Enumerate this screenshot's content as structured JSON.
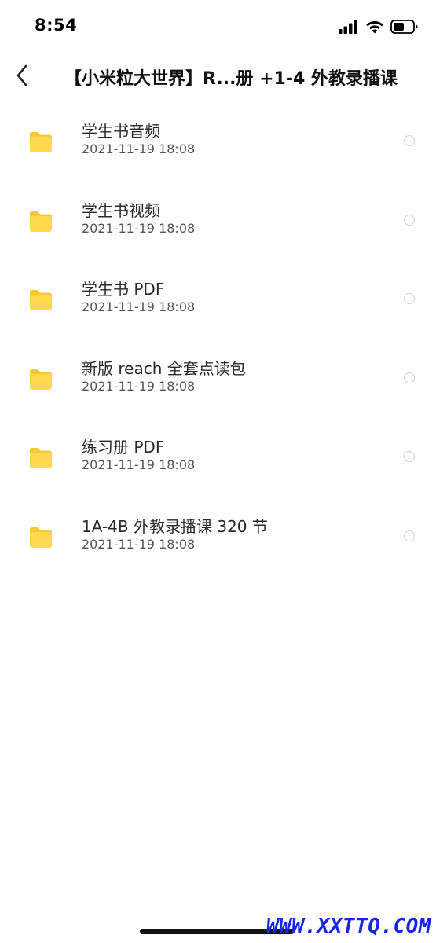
{
  "status_bar": {
    "time": "8:54",
    "icons": [
      "signal-icon",
      "wifi-icon",
      "battery-icon"
    ]
  },
  "header": {
    "back_icon": "chevron-left-icon",
    "title": "【小米粒大世界】R...册 +1-4 外教录播课"
  },
  "files": [
    {
      "name": "学生书音频",
      "date": "2021-11-19 18:08",
      "icon": "folder-icon"
    },
    {
      "name": "学生书视频",
      "date": "2021-11-19 18:08",
      "icon": "folder-icon"
    },
    {
      "name": "学生书 PDF",
      "date": "2021-11-19 18:08",
      "icon": "folder-icon"
    },
    {
      "name": "新版 reach 全套点读包",
      "date": "2021-11-19 18:08",
      "icon": "folder-icon"
    },
    {
      "name": "练习册 PDF",
      "date": "2021-11-19 18:08",
      "icon": "folder-icon"
    },
    {
      "name": "1A-4B 外教录播课 320 节",
      "date": "2021-11-19 18:08",
      "icon": "folder-icon"
    }
  ],
  "watermark": "WWW.XXTTQ.COM",
  "colors": {
    "folder": "#FFD84D",
    "folder_tab": "#F5C83C",
    "watermark": "#1A26E6",
    "radio_border": "#D0D0D0"
  }
}
